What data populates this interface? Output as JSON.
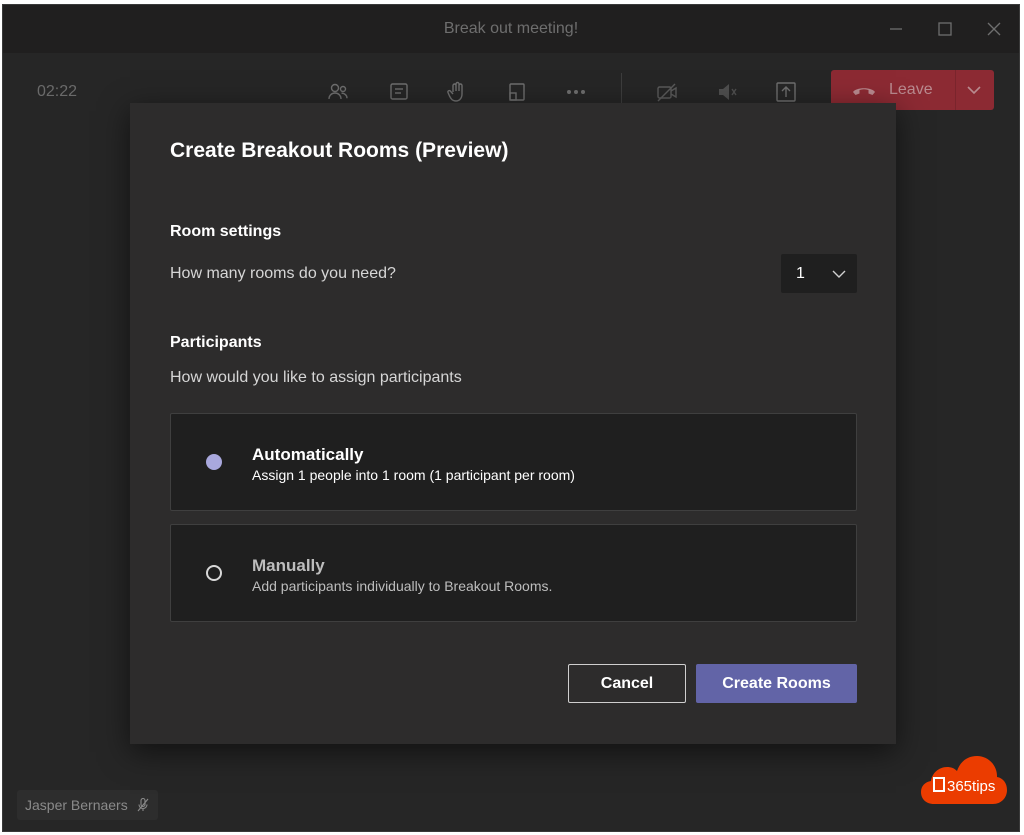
{
  "window": {
    "title": "Break out meeting!",
    "controls": [
      "minimize-icon",
      "maximize-icon",
      "close-icon"
    ]
  },
  "toolbar": {
    "timer": "02:22",
    "icons": [
      "participants-icon",
      "chat-icon",
      "raise-hand-icon",
      "rooms-icon",
      "more-options-icon",
      "camera-off-icon",
      "mic-muted-icon",
      "share-screen-icon"
    ],
    "leave_label": "Leave",
    "leave_color": "#8c2a33"
  },
  "dialog": {
    "title": "Create Breakout Rooms (Preview)",
    "room_settings": {
      "heading": "Room settings",
      "question": "How many rooms do you need?",
      "selected_rooms": "1"
    },
    "participants": {
      "heading": "Participants",
      "question": "How would you like to assign participants",
      "options": [
        {
          "title": "Automatically",
          "description": "Assign 1 people into 1 room (1 participant per room)",
          "selected": true
        },
        {
          "title": "Manually",
          "description": "Add participants individually to Breakout Rooms.",
          "selected": false
        }
      ]
    },
    "buttons": {
      "cancel": "Cancel",
      "create": "Create Rooms"
    },
    "accent_color": "#6264a7"
  },
  "participant_tile": {
    "name": "Jasper Bernaers",
    "icon": "mic-muted-icon"
  },
  "badge": {
    "text": "365tips",
    "color": "#eb3c00"
  }
}
